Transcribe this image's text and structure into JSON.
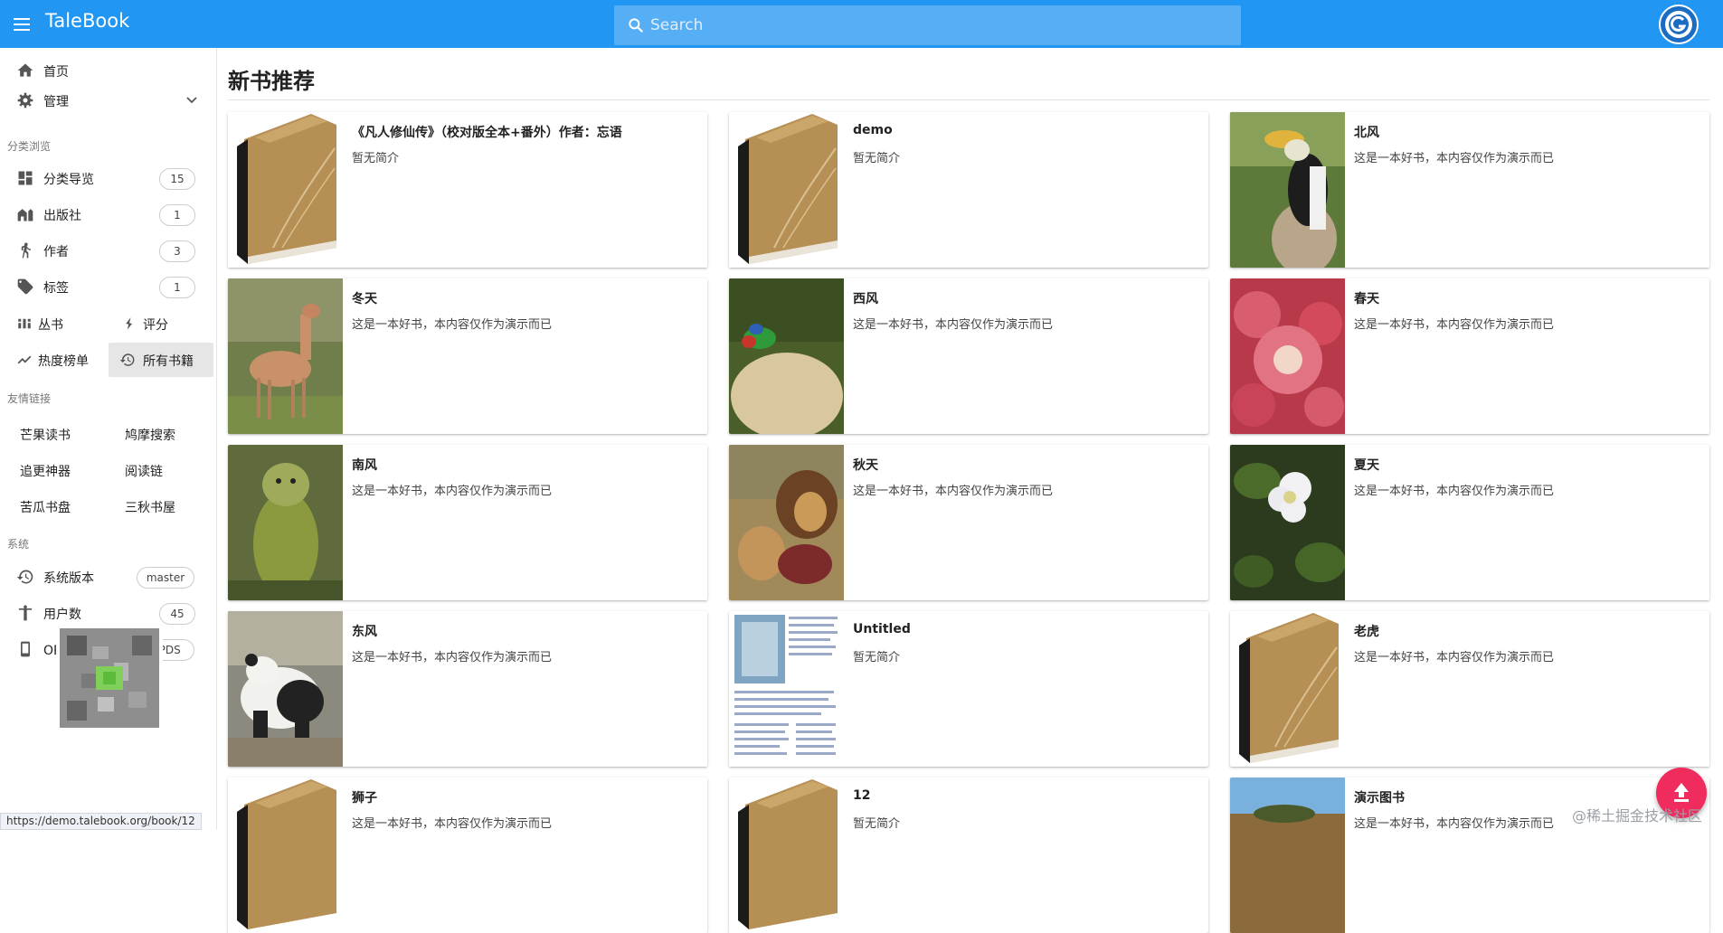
{
  "app": {
    "title": "TaleBook"
  },
  "search": {
    "placeholder": "Search"
  },
  "sidebar": {
    "home": "首页",
    "admin": "管理",
    "browse_header": "分类浏览",
    "browse": [
      {
        "label": "分类导览",
        "count": "15"
      },
      {
        "label": "出版社",
        "count": "1"
      },
      {
        "label": "作者",
        "count": "3"
      },
      {
        "label": "标签",
        "count": "1"
      }
    ],
    "series": "丛书",
    "rating": "评分",
    "hot": "热度榜单",
    "all_books": "所有书籍",
    "friends_header": "友情链接",
    "friends": [
      "芒果读书",
      "鸠摩搜索",
      "追更神器",
      "阅读链",
      "苦瓜书盘",
      "三秋书屋"
    ],
    "system_header": "系统",
    "system": [
      {
        "label": "系统版本",
        "value": "master"
      },
      {
        "label": "用户数",
        "value": "45"
      },
      {
        "label": "OPDS接口",
        "value": "OPDS"
      }
    ]
  },
  "main": {
    "title": "新书推荐",
    "books": [
      {
        "title": "《凡人修仙传》（校对版全本+番外）作者：忘语",
        "desc": "暂无简介",
        "cover": "default"
      },
      {
        "title": "demo",
        "desc": "暂无简介",
        "cover": "default"
      },
      {
        "title": "北风",
        "desc": "这是一本好书，本内容仅作为演示而已",
        "cover": "hornbill"
      },
      {
        "title": "冬天",
        "desc": "这是一本好书，本内容仅作为演示而已",
        "cover": "deer"
      },
      {
        "title": "西风",
        "desc": "这是一本好书，本内容仅作为演示而已",
        "cover": "parrot"
      },
      {
        "title": "春天",
        "desc": "这是一本好书，本内容仅作为演示而已",
        "cover": "redflower"
      },
      {
        "title": "南风",
        "desc": "这是一本好书，本内容仅作为演示而已",
        "cover": "kakapo"
      },
      {
        "title": "秋天",
        "desc": "这是一本好书，本内容仅作为演示而已",
        "cover": "lion"
      },
      {
        "title": "夏天",
        "desc": "这是一本好书，本内容仅作为演示而已",
        "cover": "whiteflower"
      },
      {
        "title": "东风",
        "desc": "这是一本好书，本内容仅作为演示而已",
        "cover": "panda"
      },
      {
        "title": "Untitled",
        "desc": "暂无简介",
        "cover": "document"
      },
      {
        "title": "老虎",
        "desc": "这是一本好书，本内容仅作为演示而已",
        "cover": "default"
      },
      {
        "title": "狮子",
        "desc": "这是一本好书，本内容仅作为演示而已",
        "cover": "default"
      },
      {
        "title": "12",
        "desc": "暂无简介",
        "cover": "default"
      },
      {
        "title": "演示图书",
        "desc": "这是一本好书，本内容仅作为演示而已",
        "cover": "sky"
      }
    ]
  },
  "status_url": "https://demo.talebook.org/book/12",
  "watermark": "@稀土掘金技术社区",
  "colors": {
    "primary": "#2196f3",
    "fab": "#f02b5e",
    "active_item": "#e6e6e6"
  }
}
